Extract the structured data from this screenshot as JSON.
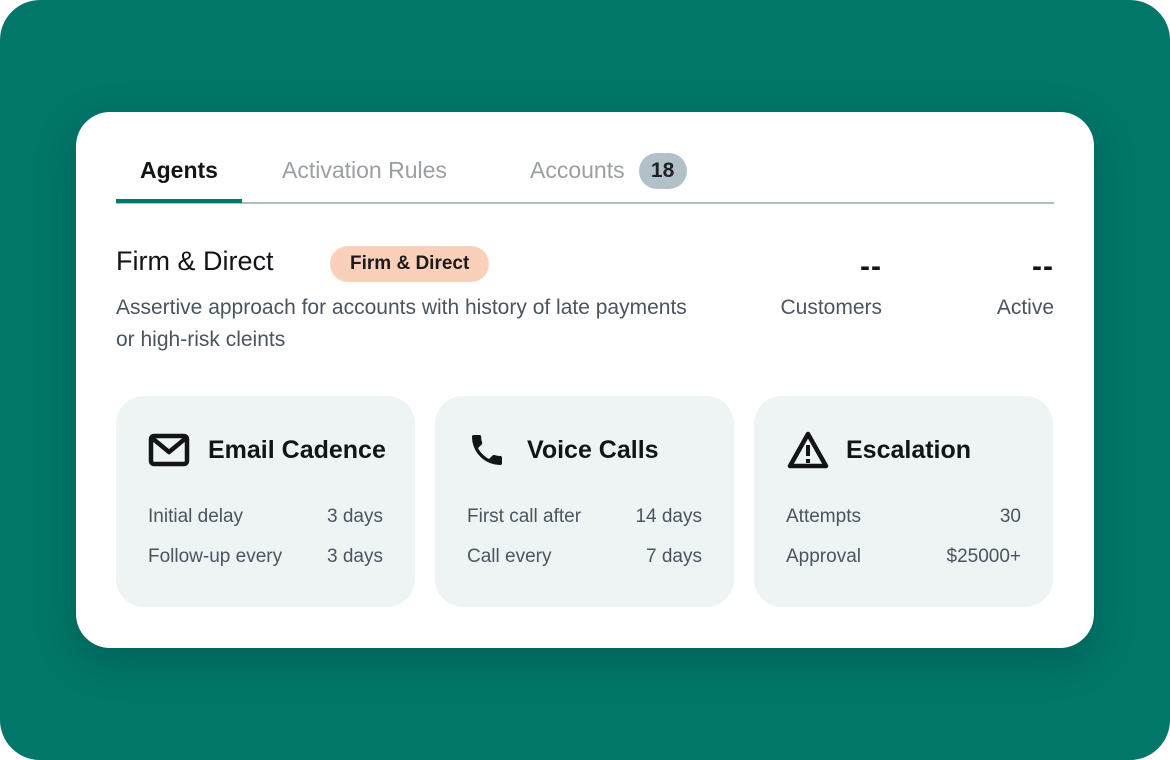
{
  "colors": {
    "background": "#01776a",
    "card": "#ffffff",
    "accent": "#017868",
    "tag_bg": "#fbd0bb",
    "badge_bg": "#b2c1c7",
    "feature_bg": "#eef3f4"
  },
  "tabs": [
    {
      "label": "Agents",
      "active": true
    },
    {
      "label": "Activation Rules",
      "active": false
    },
    {
      "label": "Accounts",
      "active": false,
      "badge": "18"
    }
  ],
  "agent": {
    "title": "Firm & Direct",
    "tag": "Firm & Direct",
    "description": "Assertive approach for accounts with history of late payments or high-risk cleints"
  },
  "stats": [
    {
      "value": "--",
      "label": "Customers"
    },
    {
      "value": "--",
      "label": "Active"
    }
  ],
  "features": [
    {
      "icon": "mail-icon",
      "title": "Email Cadence",
      "rows": [
        {
          "key": "Initial delay",
          "value": "3 days"
        },
        {
          "key": "Follow-up every",
          "value": "3 days"
        }
      ]
    },
    {
      "icon": "phone-icon",
      "title": "Voice Calls",
      "rows": [
        {
          "key": "First call after",
          "value": "14 days"
        },
        {
          "key": "Call every",
          "value": "7 days"
        }
      ]
    },
    {
      "icon": "warning-icon",
      "title": "Escalation",
      "rows": [
        {
          "key": "Attempts",
          "value": "30"
        },
        {
          "key": "Approval",
          "value": "$25000+"
        }
      ]
    }
  ]
}
